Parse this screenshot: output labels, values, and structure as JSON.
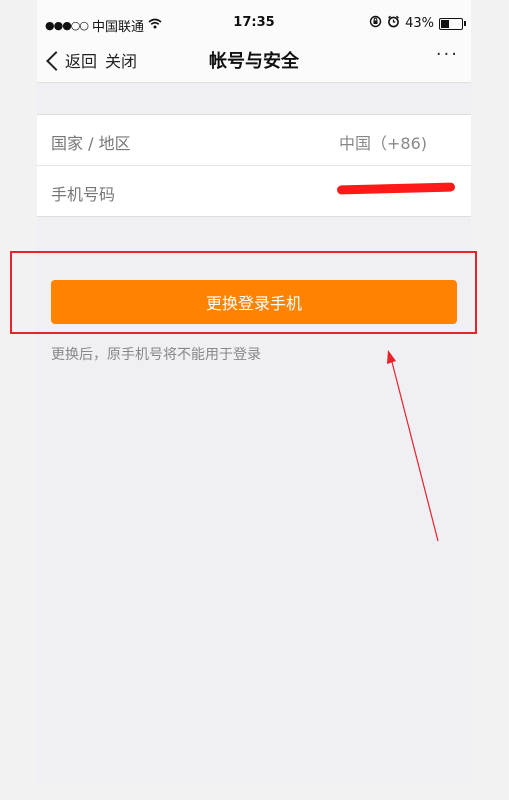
{
  "status_bar": {
    "signal_dots": "●●●○○",
    "carrier": "中国联通",
    "wifi_icon": "wifi-icon",
    "time": "17:35",
    "battery_percent": "43%",
    "battery_level": 0.43
  },
  "nav": {
    "back_label": "返回",
    "close_label": "关闭",
    "title": "帐号与安全",
    "more_label": "···"
  },
  "form": {
    "rows": [
      {
        "label": "国家 / 地区",
        "value": "中国（+86)"
      },
      {
        "label": "手机号码",
        "value": ""
      }
    ]
  },
  "action": {
    "button_label": "更换登录手机",
    "hint": "更换后，原手机号将不能用于登录"
  },
  "colors": {
    "accent": "#ff8200",
    "annotation": "#e8232a",
    "redaction": "#ff1a1a"
  }
}
